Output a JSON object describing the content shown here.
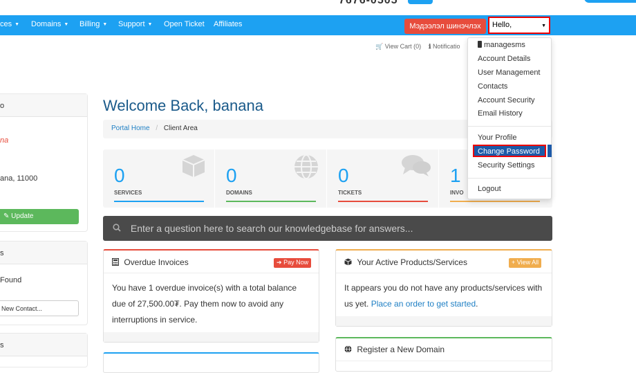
{
  "header": {
    "phone_partial": "7676-0505"
  },
  "nav": {
    "items": [
      {
        "label": "ces",
        "caret": true
      },
      {
        "label": "Domains",
        "caret": true
      },
      {
        "label": "Billing",
        "caret": true
      },
      {
        "label": "Support",
        "caret": true
      },
      {
        "label": "Open Ticket",
        "caret": false
      },
      {
        "label": "Affiliates",
        "caret": false
      }
    ],
    "info_update_button": "Мэдээлэл шинэчлэх",
    "hello_select": "Hello,"
  },
  "subnav": {
    "view_cart": "View Cart (0)",
    "notifications": "Notificatio"
  },
  "sidebar": {
    "panel1_head": "o",
    "panel1_name": "na",
    "panel1_address": "ana, 11000",
    "update_button": "Update",
    "panel2_head": "s",
    "panel2_text": "Found",
    "new_contact_button": "New Contact...",
    "panel3_head": "s"
  },
  "main": {
    "welcome": "Welcome Back, banana",
    "breadcrumb": {
      "home": "Portal Home",
      "separator": "/",
      "current": "Client Area"
    },
    "tiles": [
      {
        "number": "0",
        "label": "SERVICES",
        "color": "#1da1f2"
      },
      {
        "number": "0",
        "label": "DOMAINS",
        "color": "#5cb85c"
      },
      {
        "number": "0",
        "label": "TICKETS",
        "color": "#e74c3c"
      },
      {
        "number": "1",
        "label": "INVO",
        "color": "#f0ad4e"
      }
    ],
    "kb_search_placeholder": "Enter a question here to search our knowledgebase for answers...",
    "overdue": {
      "title": "Overdue Invoices",
      "button": "Pay Now",
      "body": "You have 1 overdue invoice(s) with a total balance due of 27,500.00₮. Pay them now to avoid any interruptions in service."
    },
    "products": {
      "title": "Your Active Products/Services",
      "button": "View All",
      "body": "It appears you do not have any products/services with us yet.",
      "link": "Place an order to get started",
      "link_suffix": "."
    },
    "register_domain": {
      "title": "Register a New Domain"
    }
  },
  "dropdown": {
    "items": [
      "managesms",
      "Account Details",
      "User Management",
      "Contacts",
      "Account Security",
      "Email History",
      "Your Profile",
      "Change Password",
      "Security Settings",
      "Logout"
    ]
  },
  "colors": {
    "brand_blue": "#1da1f2",
    "danger": "#e74c3c",
    "success": "#5cb85c",
    "warning": "#f0ad4e",
    "highlight": "#1d5aa8"
  }
}
